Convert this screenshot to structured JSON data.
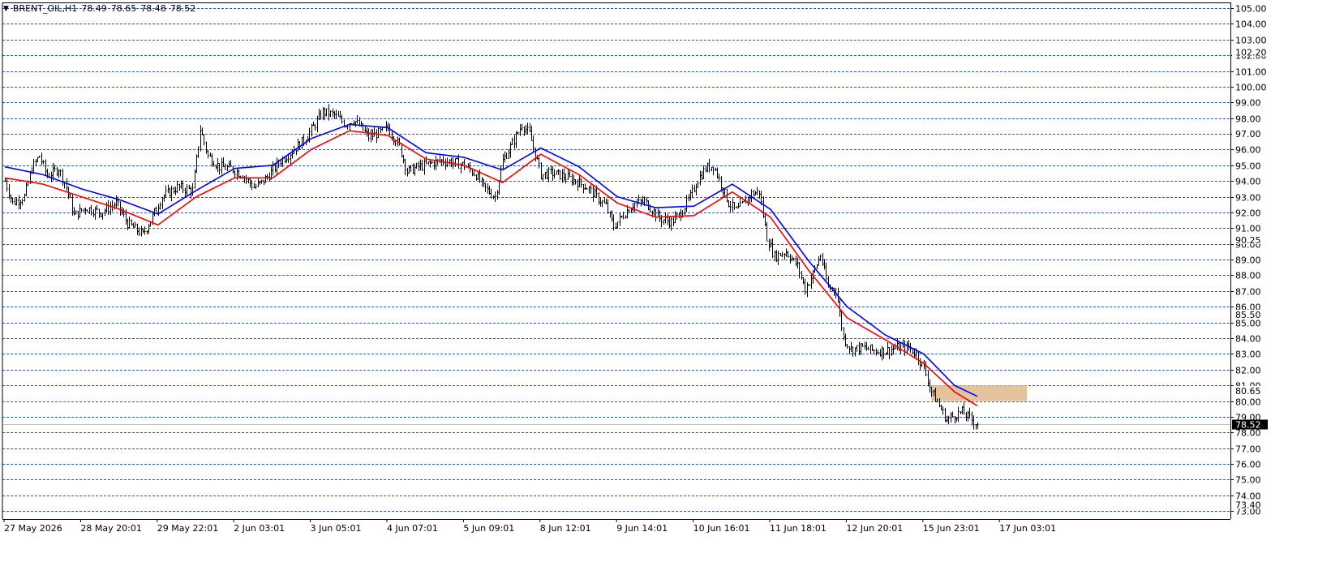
{
  "header": {
    "symbol": "BRENT_OIL,H1",
    "ohlc": [
      "78.49",
      "78.65",
      "78.48",
      "78.52"
    ]
  },
  "colors": {
    "background": "#ffffff",
    "grid": "#2e56c4",
    "candle": "#000000",
    "ma_fast": "#0000ff",
    "ma_slow": "#ff0000",
    "zone": "#deb887",
    "current_price_line": "#c0c0c0",
    "current_price_badge": "#000000"
  },
  "chart_data": {
    "type": "line",
    "title": "BRENT_OIL,H1",
    "ylim": [
      72.9,
      105.4
    ],
    "y_ticks": [
      105,
      104,
      103,
      102,
      101,
      100,
      99,
      98,
      97,
      96,
      95,
      94,
      93,
      92,
      91,
      90,
      89,
      88,
      87,
      86,
      85,
      84,
      83,
      82,
      81,
      80,
      79,
      78,
      77,
      76,
      75,
      74,
      73
    ],
    "y_tick_labels": [
      "105.00",
      "104.00",
      "103.00",
      "102.00",
      "101.00",
      "100.00",
      "99.00",
      "98.00",
      "97.00",
      "96.00",
      "95.00",
      "94.00",
      "93.00",
      "92.00",
      "91.00",
      "90.00",
      "89.00",
      "88.00",
      "87.00",
      "86.00",
      "85.00",
      "84.00",
      "83.00",
      "82.00",
      "81.00",
      "80.00",
      "79.00",
      "78.00",
      "77.00",
      "76.00",
      "75.00",
      "74.00",
      "73.00"
    ],
    "extra_price_labels": [
      {
        "value": 102.2,
        "text": "102.20"
      },
      {
        "value": 97.0,
        "text": "97.00"
      },
      {
        "value": 90.25,
        "text": "90.25"
      },
      {
        "value": 85.5,
        "text": "85.50"
      },
      {
        "value": 80.65,
        "text": "80.65"
      },
      {
        "value": 73.4,
        "text": "73.40"
      }
    ],
    "current_price": {
      "value": 78.52,
      "text": "78.52"
    },
    "x_range": [
      0,
      245
    ],
    "x_ticks": [
      {
        "x": 0,
        "label": "27 May 2026"
      },
      {
        "x": 20,
        "label": "28 May 20:01"
      },
      {
        "x": 40,
        "label": "29 May 22:01"
      },
      {
        "x": 60,
        "label": "2 Jun 03:01"
      },
      {
        "x": 80,
        "label": "3 Jun 05:01"
      },
      {
        "x": 100,
        "label": "4 Jun 07:01"
      },
      {
        "x": 120,
        "label": "5 Jun 09:01"
      },
      {
        "x": 140,
        "label": "8 Jun 12:01"
      },
      {
        "x": 160,
        "label": "9 Jun 14:01"
      },
      {
        "x": 180,
        "label": "10 Jun 16:01"
      },
      {
        "x": 200,
        "label": "11 Jun 18:01"
      },
      {
        "x": 220,
        "label": "12 Jun 20:01"
      },
      {
        "x": 240,
        "label": "15 Jun 23:01"
      },
      {
        "x": 260,
        "label": "17 Jun 03:01"
      }
    ],
    "price_path": [
      [
        0,
        94.0
      ],
      [
        2,
        92.6
      ],
      [
        5,
        93.0
      ],
      [
        7,
        94.8
      ],
      [
        9,
        95.6
      ],
      [
        11,
        94.3
      ],
      [
        14,
        94.8
      ],
      [
        16,
        93.6
      ],
      [
        18,
        91.8
      ],
      [
        21,
        92.3
      ],
      [
        25,
        92.0
      ],
      [
        29,
        92.6
      ],
      [
        32,
        91.3
      ],
      [
        36,
        90.6
      ],
      [
        38,
        91.5
      ],
      [
        41,
        93.0
      ],
      [
        45,
        93.6
      ],
      [
        49,
        93.4
      ],
      [
        51,
        97.3
      ],
      [
        53,
        95.6
      ],
      [
        56,
        94.9
      ],
      [
        59,
        94.8
      ],
      [
        62,
        94.4
      ],
      [
        65,
        93.6
      ],
      [
        67,
        93.9
      ],
      [
        69,
        94.4
      ],
      [
        72,
        95.3
      ],
      [
        75,
        95.9
      ],
      [
        78,
        96.6
      ],
      [
        81,
        97.6
      ],
      [
        83,
        98.4
      ],
      [
        86,
        98.2
      ],
      [
        89,
        97.6
      ],
      [
        91,
        97.9
      ],
      [
        93,
        97.4
      ],
      [
        95,
        96.8
      ],
      [
        98,
        97.1
      ],
      [
        100,
        97.4
      ],
      [
        103,
        96.2
      ],
      [
        105,
        94.6
      ],
      [
        108,
        94.9
      ],
      [
        111,
        95.1
      ],
      [
        114,
        95.3
      ],
      [
        117,
        95.2
      ],
      [
        120,
        95.0
      ],
      [
        123,
        94.4
      ],
      [
        125,
        93.6
      ],
      [
        128,
        93.0
      ],
      [
        130,
        95.3
      ],
      [
        133,
        96.6
      ],
      [
        135,
        97.6
      ],
      [
        137,
        97.0
      ],
      [
        140,
        94.4
      ],
      [
        143,
        94.5
      ],
      [
        146,
        94.3
      ],
      [
        149,
        94.0
      ],
      [
        152,
        93.6
      ],
      [
        154,
        93.1
      ],
      [
        157,
        92.4
      ],
      [
        159,
        91.1
      ],
      [
        162,
        92.0
      ],
      [
        164,
        92.5
      ],
      [
        167,
        92.7
      ],
      [
        169,
        92.2
      ],
      [
        171,
        91.6
      ],
      [
        174,
        91.4
      ],
      [
        176,
        91.8
      ],
      [
        179,
        93.0
      ],
      [
        181,
        94.1
      ],
      [
        183,
        94.8
      ],
      [
        185,
        95.0
      ],
      [
        187,
        93.8
      ],
      [
        189,
        92.6
      ],
      [
        191,
        92.1
      ],
      [
        193,
        92.6
      ],
      [
        195,
        93.2
      ],
      [
        197,
        93.3
      ],
      [
        199,
        90.4
      ],
      [
        201,
        89.2
      ],
      [
        204,
        89.5
      ],
      [
        207,
        88.6
      ],
      [
        209,
        87.1
      ],
      [
        211,
        88.1
      ],
      [
        213,
        89.3
      ],
      [
        215,
        87.2
      ],
      [
        217,
        87.1
      ],
      [
        219,
        84.0
      ],
      [
        221,
        83.3
      ],
      [
        224,
        83.4
      ],
      [
        227,
        83.2
      ],
      [
        230,
        83.2
      ],
      [
        233,
        83.4
      ],
      [
        236,
        83.4
      ],
      [
        238,
        83.0
      ],
      [
        240,
        82.1
      ],
      [
        242,
        80.6
      ],
      [
        244,
        79.7
      ],
      [
        246,
        78.8
      ],
      [
        248,
        79.1
      ],
      [
        250,
        79.3
      ],
      [
        252,
        78.9
      ],
      [
        254,
        78.52
      ]
    ],
    "series": [
      {
        "name": "",
        "role": "ma_fast",
        "values": [
          [
            0,
            94.9
          ],
          [
            10,
            94.4
          ],
          [
            20,
            93.5
          ],
          [
            30,
            92.8
          ],
          [
            40,
            91.9
          ],
          [
            50,
            93.4
          ],
          [
            60,
            94.8
          ],
          [
            70,
            95.0
          ],
          [
            80,
            96.7
          ],
          [
            90,
            97.6
          ],
          [
            100,
            97.4
          ],
          [
            110,
            95.8
          ],
          [
            120,
            95.5
          ],
          [
            130,
            94.7
          ],
          [
            140,
            96.1
          ],
          [
            150,
            94.9
          ],
          [
            160,
            93.0
          ],
          [
            170,
            92.3
          ],
          [
            180,
            92.4
          ],
          [
            190,
            93.8
          ],
          [
            200,
            92.2
          ],
          [
            210,
            88.9
          ],
          [
            220,
            86.0
          ],
          [
            230,
            84.2
          ],
          [
            240,
            83.0
          ],
          [
            248,
            81.0
          ],
          [
            254,
            80.3
          ]
        ]
      },
      {
        "name": "",
        "role": "ma_slow",
        "values": [
          [
            0,
            94.2
          ],
          [
            10,
            93.8
          ],
          [
            20,
            93.0
          ],
          [
            30,
            92.2
          ],
          [
            40,
            91.2
          ],
          [
            50,
            93.0
          ],
          [
            60,
            94.2
          ],
          [
            70,
            94.2
          ],
          [
            80,
            96.0
          ],
          [
            90,
            97.2
          ],
          [
            100,
            96.9
          ],
          [
            110,
            95.4
          ],
          [
            120,
            95.0
          ],
          [
            130,
            93.9
          ],
          [
            140,
            95.7
          ],
          [
            150,
            94.4
          ],
          [
            160,
            92.6
          ],
          [
            170,
            91.7
          ],
          [
            180,
            91.8
          ],
          [
            190,
            93.3
          ],
          [
            200,
            91.7
          ],
          [
            210,
            88.3
          ],
          [
            220,
            85.3
          ],
          [
            230,
            83.9
          ],
          [
            240,
            82.4
          ],
          [
            248,
            80.6
          ],
          [
            254,
            79.7
          ]
        ]
      }
    ],
    "zones": [
      {
        "x_start": 242,
        "x_end": 267,
        "y_low": 80.0,
        "y_high": 81.0
      }
    ]
  }
}
